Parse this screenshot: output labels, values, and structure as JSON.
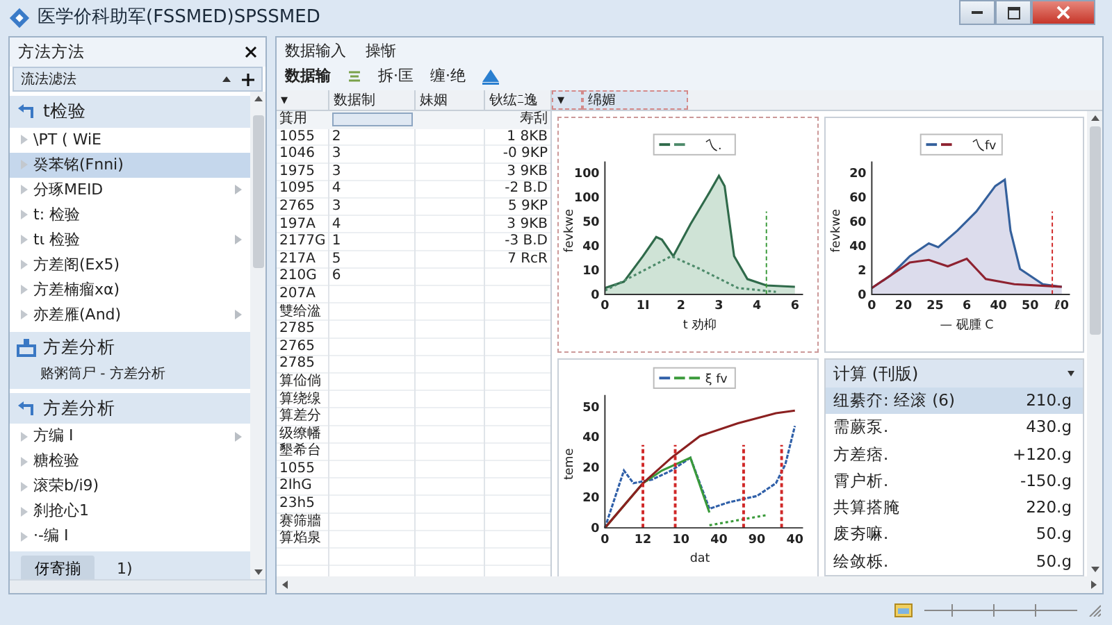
{
  "window": {
    "title": "医学价科助军(FSSMED)SPSSMED"
  },
  "left_panel": {
    "title": "方法方法",
    "subtitle": "流法滤法",
    "sections": [
      {
        "title": "t检验",
        "items": [
          {
            "label": "\\PT ( WiE",
            "selected": false,
            "arrow": false
          },
          {
            "label": "癸苯铭(Fnni)",
            "selected": true,
            "arrow": false
          },
          {
            "label": "分琢MEID",
            "selected": false,
            "arrow": true
          },
          {
            "label": "t: 检验",
            "selected": false,
            "arrow": false
          },
          {
            "label": "tι 检验",
            "selected": false,
            "arrow": true
          },
          {
            "label": "方差阁(Ex5)",
            "selected": false,
            "arrow": false
          },
          {
            "label": "方差楠瘤xα)",
            "selected": false,
            "arrow": false
          },
          {
            "label": "亦差雁(And)",
            "selected": false,
            "arrow": true
          }
        ]
      },
      {
        "title": "方差分析",
        "subtitle": "赂粥筒尸 - 方差分析"
      },
      {
        "title": "方差分析",
        "items": [
          {
            "label": "方编 I",
            "selected": false,
            "arrow": true
          },
          {
            "label": "糖检验",
            "selected": false,
            "arrow": false
          },
          {
            "label": "滚荣b/i9)",
            "selected": false,
            "arrow": false
          },
          {
            "label": "刹抢心1",
            "selected": false,
            "arrow": false
          },
          {
            "label": "·-编 I",
            "selected": false,
            "arrow": false
          }
        ]
      }
    ],
    "footer": {
      "button": "伢寄揃",
      "text": "1)"
    }
  },
  "menu": [
    "数据输入",
    "操惭"
  ],
  "toolbar": {
    "title": "数据输",
    "items": [
      "拆·匡",
      "缠·绝"
    ]
  },
  "table": {
    "columns": [
      "▾",
      "数据制",
      "妹姻",
      "钬纮ﾆ逸",
      "▾",
      "绵媚"
    ],
    "subheader": {
      "column_1": "箕用",
      "column_4": "寿刮"
    },
    "rows": [
      [
        "1055",
        "2",
        "1 8KB"
      ],
      [
        "1046",
        "3",
        "-0 9KP"
      ],
      [
        "1975",
        "3",
        "3 9KB"
      ],
      [
        "1095",
        "4",
        "-2 B.D"
      ],
      [
        "2765",
        "3",
        "5 9KP"
      ],
      [
        "197A",
        "4",
        "3 9KB"
      ],
      [
        "2177G",
        "1",
        "-3 B.D"
      ],
      [
        "217A",
        "5",
        "7 RcR"
      ],
      [
        "210G",
        "6",
        null
      ],
      [
        "207A",
        null,
        null
      ],
      [
        "雙给湓",
        null,
        null
      ],
      [
        "2785",
        null,
        null
      ],
      [
        "2765",
        null,
        null
      ],
      [
        "2785",
        null,
        null
      ],
      [
        "算佡倘",
        null,
        null
      ],
      [
        "算绕缐",
        null,
        null
      ],
      [
        "算差分",
        null,
        null
      ],
      [
        "级缭幡",
        null,
        null
      ],
      [
        "墾希台",
        null,
        null
      ],
      [
        "1055",
        null,
        null
      ],
      [
        "2IhG",
        null,
        null
      ],
      [
        "23h5",
        null,
        null
      ],
      [
        "赛筛牆",
        null,
        null
      ],
      [
        "算焰泉",
        null,
        null
      ]
    ]
  },
  "charts": [
    {
      "kind": "area1",
      "legend": "乀.",
      "ylabel": "fevkwe",
      "xlabel": "t 劝枊",
      "yticks": [
        "100",
        "100",
        "50",
        "40",
        "10",
        "0"
      ],
      "xticks": [
        "0",
        "1Ⅰ",
        "2",
        "3",
        "4",
        "6"
      ]
    },
    {
      "kind": "area2",
      "legend": "乀fv",
      "ylabel": "fevkwe",
      "xlabel": "— 砚腫 C",
      "yticks": [
        "20",
        "60",
        "60",
        "40",
        "2",
        "0"
      ],
      "xticks": [
        "0",
        "20",
        "25",
        "6",
        "40",
        "50",
        "ℓ0"
      ]
    },
    {
      "kind": "lines",
      "legend": "ξ fv",
      "ylabel": "teme",
      "xlabel": "dat",
      "yticks": [
        "50",
        "40",
        "20",
        "20",
        "0"
      ],
      "xticks": [
        "0",
        "12",
        "10",
        "40",
        "90",
        "40"
      ]
    }
  ],
  "calc": {
    "title": "计算 (刊版)",
    "rows": [
      {
        "label": "纽綦夰: 经滚 (6)",
        "value": "210.g",
        "selected": true
      },
      {
        "label": "需蕨泵.",
        "value": "430.g",
        "selected": false
      },
      {
        "label": "方差痞.",
        "value": "+120.g",
        "selected": false
      },
      {
        "label": "霄户析.",
        "value": "-150.g",
        "selected": false
      },
      {
        "label": "共算搭腌",
        "value": "220.g",
        "selected": false
      },
      {
        "label": "废夯嘛.",
        "value": "50.g",
        "selected": false
      },
      {
        "label": "绘敛栎.",
        "value": "50.g",
        "selected": false
      }
    ]
  }
}
